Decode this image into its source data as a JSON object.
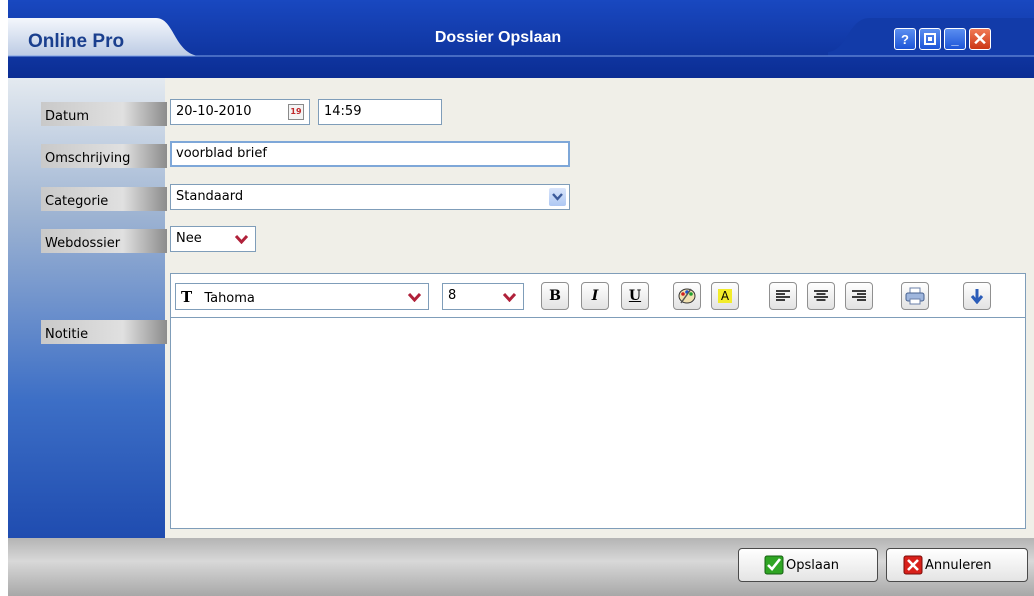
{
  "window": {
    "app_name": "Online Pro",
    "title": "Dossier Opslaan",
    "controls": {
      "help_glyph": "?",
      "minimize_glyph": "_",
      "close_glyph": "✕"
    }
  },
  "form": {
    "datum": {
      "label": "Datum",
      "date_value": "20-10-2010",
      "calendar_glyph": "19",
      "time_value": "14:59"
    },
    "omschrijving": {
      "label": "Omschrijving",
      "value": "voorblad brief"
    },
    "categorie": {
      "label": "Categorie",
      "value": "Standaard"
    },
    "webdossier": {
      "label": "Webdossier",
      "value": "Nee"
    },
    "notitie": {
      "label": "Notitie",
      "value": ""
    }
  },
  "editor_toolbar": {
    "font_icon_glyph": "T",
    "font_name": "Tahoma",
    "font_size": "8",
    "bold_glyph": "B",
    "italic_glyph": "I",
    "underline_glyph": "U",
    "highlight_glyph": "A"
  },
  "buttons": {
    "save": "Opslaan",
    "cancel": "Annuleren"
  },
  "colors": {
    "titlebar": "#0a2a8c",
    "window_bg": "#f0efe8",
    "save_check": "#2fa524",
    "cancel_x": "#d8201a"
  }
}
